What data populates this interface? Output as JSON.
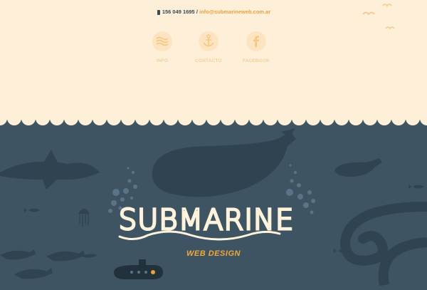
{
  "header": {
    "phone": "156 049 1695",
    "separator": "/",
    "email": "info@submarineweb.com.ar"
  },
  "nav": {
    "items": [
      {
        "label": "INFO",
        "icon": "waves-icon"
      },
      {
        "label": "CONTACTO",
        "icon": "anchor-icon"
      },
      {
        "label": "FACEBOOK",
        "icon": "facebook-icon"
      }
    ]
  },
  "hero": {
    "title": "SUBMARINE",
    "subtitle": "WEB DESIGN"
  },
  "colors": {
    "sky": "#fdefd8",
    "sea": "#3e5463",
    "accent": "#f0a83c",
    "title": "#fdf3dc"
  }
}
